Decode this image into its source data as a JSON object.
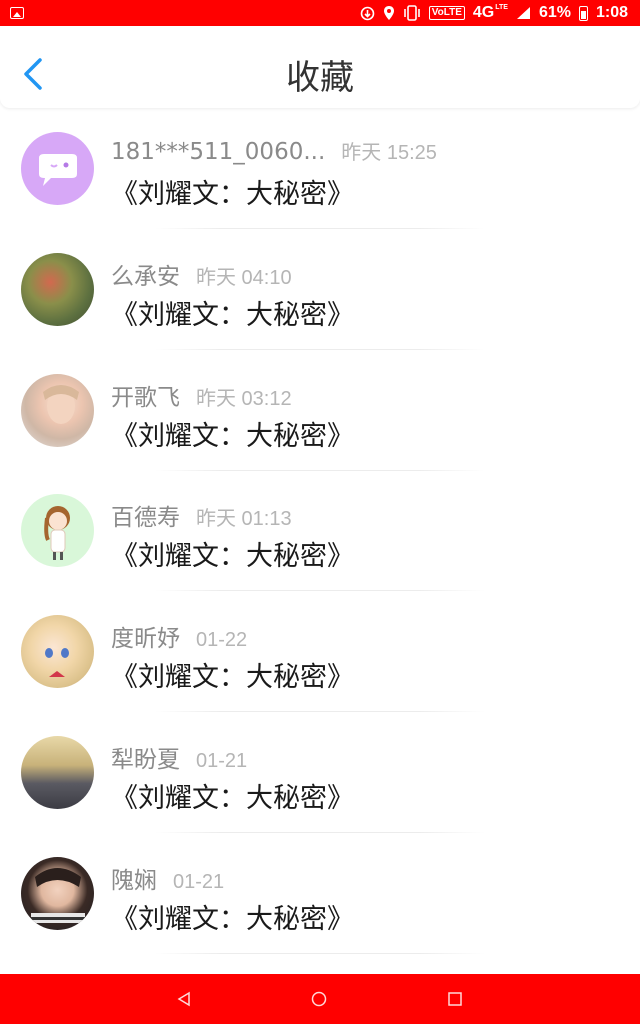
{
  "status_bar": {
    "network_badge": "VoLTE",
    "network": "4G",
    "network_sub": "LTE",
    "battery": "61%",
    "time": "1:08",
    "icons": [
      "gallery-icon",
      "download-icon",
      "location-icon",
      "vibrate-icon",
      "signal-icon",
      "battery-icon"
    ]
  },
  "header": {
    "title": "收藏",
    "back_icon": "chevron-left-icon",
    "accent_color": "#2196f3"
  },
  "favorites": [
    {
      "username": "181***511_0060...",
      "time": "昨天 15:25",
      "title": "《刘耀文：大秘密》",
      "avatar": "chat-bubble-avatar"
    },
    {
      "username": "么承安",
      "time": "昨天 04:10",
      "title": "《刘耀文：大秘密》",
      "avatar": "plant-photo-avatar"
    },
    {
      "username": "开歌飞",
      "time": "昨天 03:12",
      "title": "《刘耀文：大秘密》",
      "avatar": "portrait-photo-avatar"
    },
    {
      "username": "百德寿",
      "time": "昨天 01:13",
      "title": "《刘耀文：大秘密》",
      "avatar": "cartoon-girl-avatar"
    },
    {
      "username": "度昕妤",
      "time": "01-22",
      "title": "《刘耀文：大秘密》",
      "avatar": "anime-girl-avatar"
    },
    {
      "username": "犁盼夏",
      "time": "01-21",
      "title": "《刘耀文：大秘密》",
      "avatar": "vintage-photo-avatar"
    },
    {
      "username": "隗娴",
      "time": "01-21",
      "title": "《刘耀文：大秘密》",
      "avatar": "boy-photo-avatar"
    }
  ],
  "nav_bar": {
    "buttons": [
      "back-triangle-icon",
      "home-circle-icon",
      "recents-square-icon"
    ]
  }
}
